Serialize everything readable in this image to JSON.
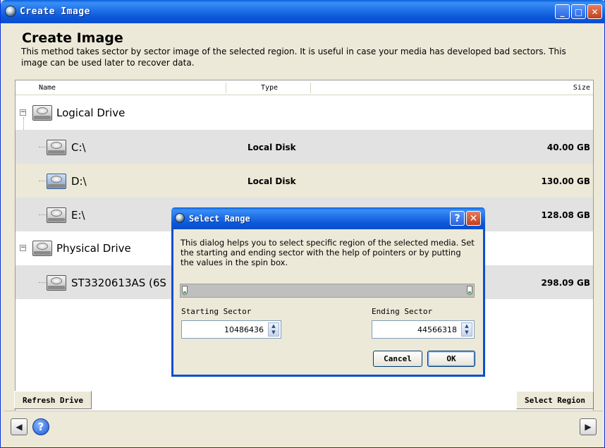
{
  "window": {
    "title": "Create Image",
    "controls": [
      "_",
      "□",
      "✕"
    ]
  },
  "header": {
    "title": "Create Image",
    "description": "This method takes sector by sector image of the selected region. It is useful in case your media has developed bad sectors. This image can be used later to recover data."
  },
  "list": {
    "columns": {
      "name": "Name",
      "type": "Type",
      "size": "Size"
    },
    "groups": [
      {
        "label": "Logical Drive",
        "expander": "−",
        "items": [
          {
            "name": "C:\\",
            "type": "Local Disk",
            "size": "40.00 GB"
          },
          {
            "name": "D:\\",
            "type": "Local Disk",
            "size": "130.00 GB"
          },
          {
            "name": "E:\\",
            "type": "",
            "size": "128.08 GB"
          }
        ]
      },
      {
        "label": "Physical Drive",
        "expander": "−",
        "items": [
          {
            "name": "ST3320613AS (6S",
            "type": "",
            "size": "298.09 GB"
          }
        ]
      }
    ]
  },
  "buttons": {
    "refresh": "Refresh Drive",
    "select_region": "Select Region",
    "back": "◀",
    "help": "?",
    "next": "▶"
  },
  "dialog": {
    "title": "Select Range",
    "help_glyph": "?",
    "close_glyph": "✕",
    "description": "This dialog helps you to select specific region of the selected media. Set the starting and ending sector with the help of pointers or by putting the values in the spin box.",
    "starting_label": "Starting Sector",
    "starting_value": "10486436",
    "ending_label": "Ending Sector",
    "ending_value": "44566318",
    "cancel": "Cancel",
    "ok": "OK"
  }
}
